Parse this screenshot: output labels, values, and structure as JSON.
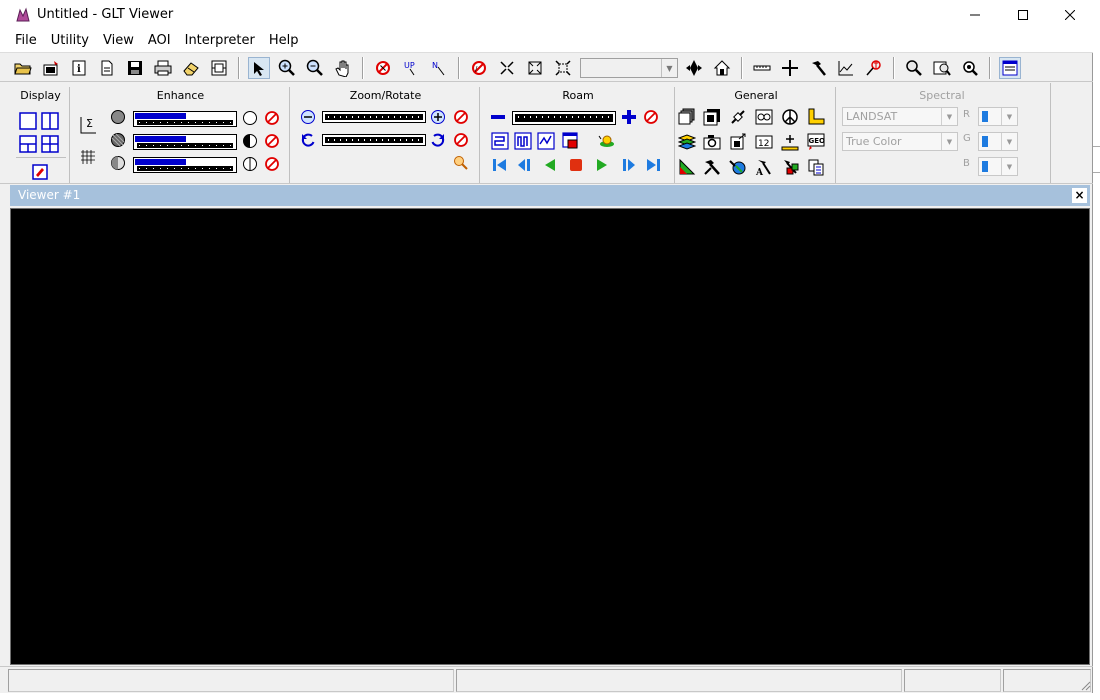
{
  "window": {
    "title": "Untitled - GLT Viewer",
    "controls": [
      "minimize",
      "maximize",
      "close"
    ]
  },
  "menu": [
    "File",
    "Utility",
    "View",
    "AOI",
    "Interpreter",
    "Help"
  ],
  "toolbar": {
    "icons": [
      "open-folder-icon",
      "open-layer-icon",
      "info-icon",
      "new-document-icon",
      "save-icon",
      "print-icon",
      "eraser-icon",
      "clear-view-icon",
      "select-arrow-icon",
      "zoom-in-icon",
      "zoom-out-icon",
      "pan-hand-icon",
      "cancel-icon",
      "north-up-icon",
      "north-arrow-icon",
      "reset-icon",
      "shrink-icon",
      "fit-icon",
      "expand-icon",
      "rotate-icon",
      "home-icon",
      "ruler-icon",
      "crosshair-icon",
      "hammer-icon",
      "profile-icon",
      "pin-icon",
      "magnifier-icon",
      "magnifier-window-icon",
      "eye-icon",
      "panel-icon"
    ],
    "combo_value": ""
  },
  "panels": {
    "display": {
      "title": "Display"
    },
    "enhance": {
      "title": "Enhance",
      "slider_levels": [
        0.5,
        0.5,
        0.5
      ]
    },
    "zoom_rotate": {
      "title": "Zoom/Rotate"
    },
    "roam": {
      "title": "Roam"
    },
    "general": {
      "title": "General"
    },
    "spectral": {
      "title": "Spectral",
      "sensor": "LANDSAT",
      "composite": "True Color",
      "bands": [
        "R",
        "G",
        "B"
      ]
    }
  },
  "viewer": {
    "title": "Viewer #1",
    "close_label": "×",
    "background": "#000000"
  },
  "colors": {
    "accent_blue": "#0000cc",
    "viewer_title_bg": "#a6c1dc",
    "cancel_red": "#e00000",
    "play_green": "#22aa22"
  }
}
